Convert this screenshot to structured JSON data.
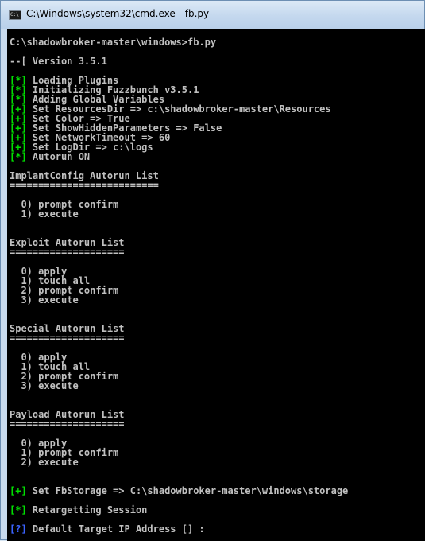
{
  "window": {
    "title": "C:\\Windows\\system32\\cmd.exe - fb.py",
    "icon_text": "C:\\",
    "colors": {
      "console_bg": "#000000",
      "console_text": "#c0c0c0",
      "tag_green": "#00e000",
      "tag_blue": "#3b63ff"
    }
  },
  "console": {
    "lines": [
      {
        "tag": "",
        "tag_color": "",
        "text": "C:\\shadowbroker-master\\windows>fb.py"
      },
      {
        "tag": "",
        "tag_color": "",
        "text": "--[ Version 3.5.1"
      },
      {
        "tag": "[*]",
        "tag_color": "green",
        "text": " Loading Plugins"
      },
      {
        "tag": "[*]",
        "tag_color": "green",
        "text": " Initializing Fuzzbunch v3.5.1"
      },
      {
        "tag": "[*]",
        "tag_color": "green",
        "text": " Adding Global Variables"
      },
      {
        "tag": "[+]",
        "tag_color": "green",
        "text": " Set ResourcesDir => c:\\shadowbroker-master\\Resources"
      },
      {
        "tag": "[+]",
        "tag_color": "green",
        "text": " Set Color => True"
      },
      {
        "tag": "[+]",
        "tag_color": "green",
        "text": " Set ShowHiddenParameters => False"
      },
      {
        "tag": "[+]",
        "tag_color": "green",
        "text": " Set NetworkTimeout => 60"
      },
      {
        "tag": "[+]",
        "tag_color": "green",
        "text": " Set LogDir => c:\\logs"
      },
      {
        "tag": "[*]",
        "tag_color": "green",
        "text": " Autorun ON"
      },
      {
        "tag": "",
        "tag_color": "",
        "text": "ImplantConfig Autorun List"
      },
      {
        "tag": "",
        "tag_color": "",
        "text": "=========================="
      },
      {
        "tag": "",
        "tag_color": "",
        "text": "  0) prompt confirm"
      },
      {
        "tag": "",
        "tag_color": "",
        "text": "  1) execute"
      },
      {
        "tag": "",
        "tag_color": "",
        "text": "Exploit Autorun List"
      },
      {
        "tag": "",
        "tag_color": "",
        "text": "===================="
      },
      {
        "tag": "",
        "tag_color": "",
        "text": "  0) apply"
      },
      {
        "tag": "",
        "tag_color": "",
        "text": "  1) touch all"
      },
      {
        "tag": "",
        "tag_color": "",
        "text": "  2) prompt confirm"
      },
      {
        "tag": "",
        "tag_color": "",
        "text": "  3) execute"
      },
      {
        "tag": "",
        "tag_color": "",
        "text": "Special Autorun List"
      },
      {
        "tag": "",
        "tag_color": "",
        "text": "===================="
      },
      {
        "tag": "",
        "tag_color": "",
        "text": "  0) apply"
      },
      {
        "tag": "",
        "tag_color": "",
        "text": "  1) touch all"
      },
      {
        "tag": "",
        "tag_color": "",
        "text": "  2) prompt confirm"
      },
      {
        "tag": "",
        "tag_color": "",
        "text": "  3) execute"
      },
      {
        "tag": "",
        "tag_color": "",
        "text": "Payload Autorun List"
      },
      {
        "tag": "",
        "tag_color": "",
        "text": "===================="
      },
      {
        "tag": "",
        "tag_color": "",
        "text": "  0) apply"
      },
      {
        "tag": "",
        "tag_color": "",
        "text": "  1) prompt confirm"
      },
      {
        "tag": "",
        "tag_color": "",
        "text": "  2) execute"
      },
      {
        "tag": "[+]",
        "tag_color": "green",
        "text": " Set FbStorage => C:\\shadowbroker-master\\windows\\storage"
      },
      {
        "tag": "[*]",
        "tag_color": "green",
        "text": " Retargetting Session"
      },
      {
        "tag": "[?]",
        "tag_color": "blue",
        "text": " Default Target IP Address [] :"
      }
    ]
  }
}
